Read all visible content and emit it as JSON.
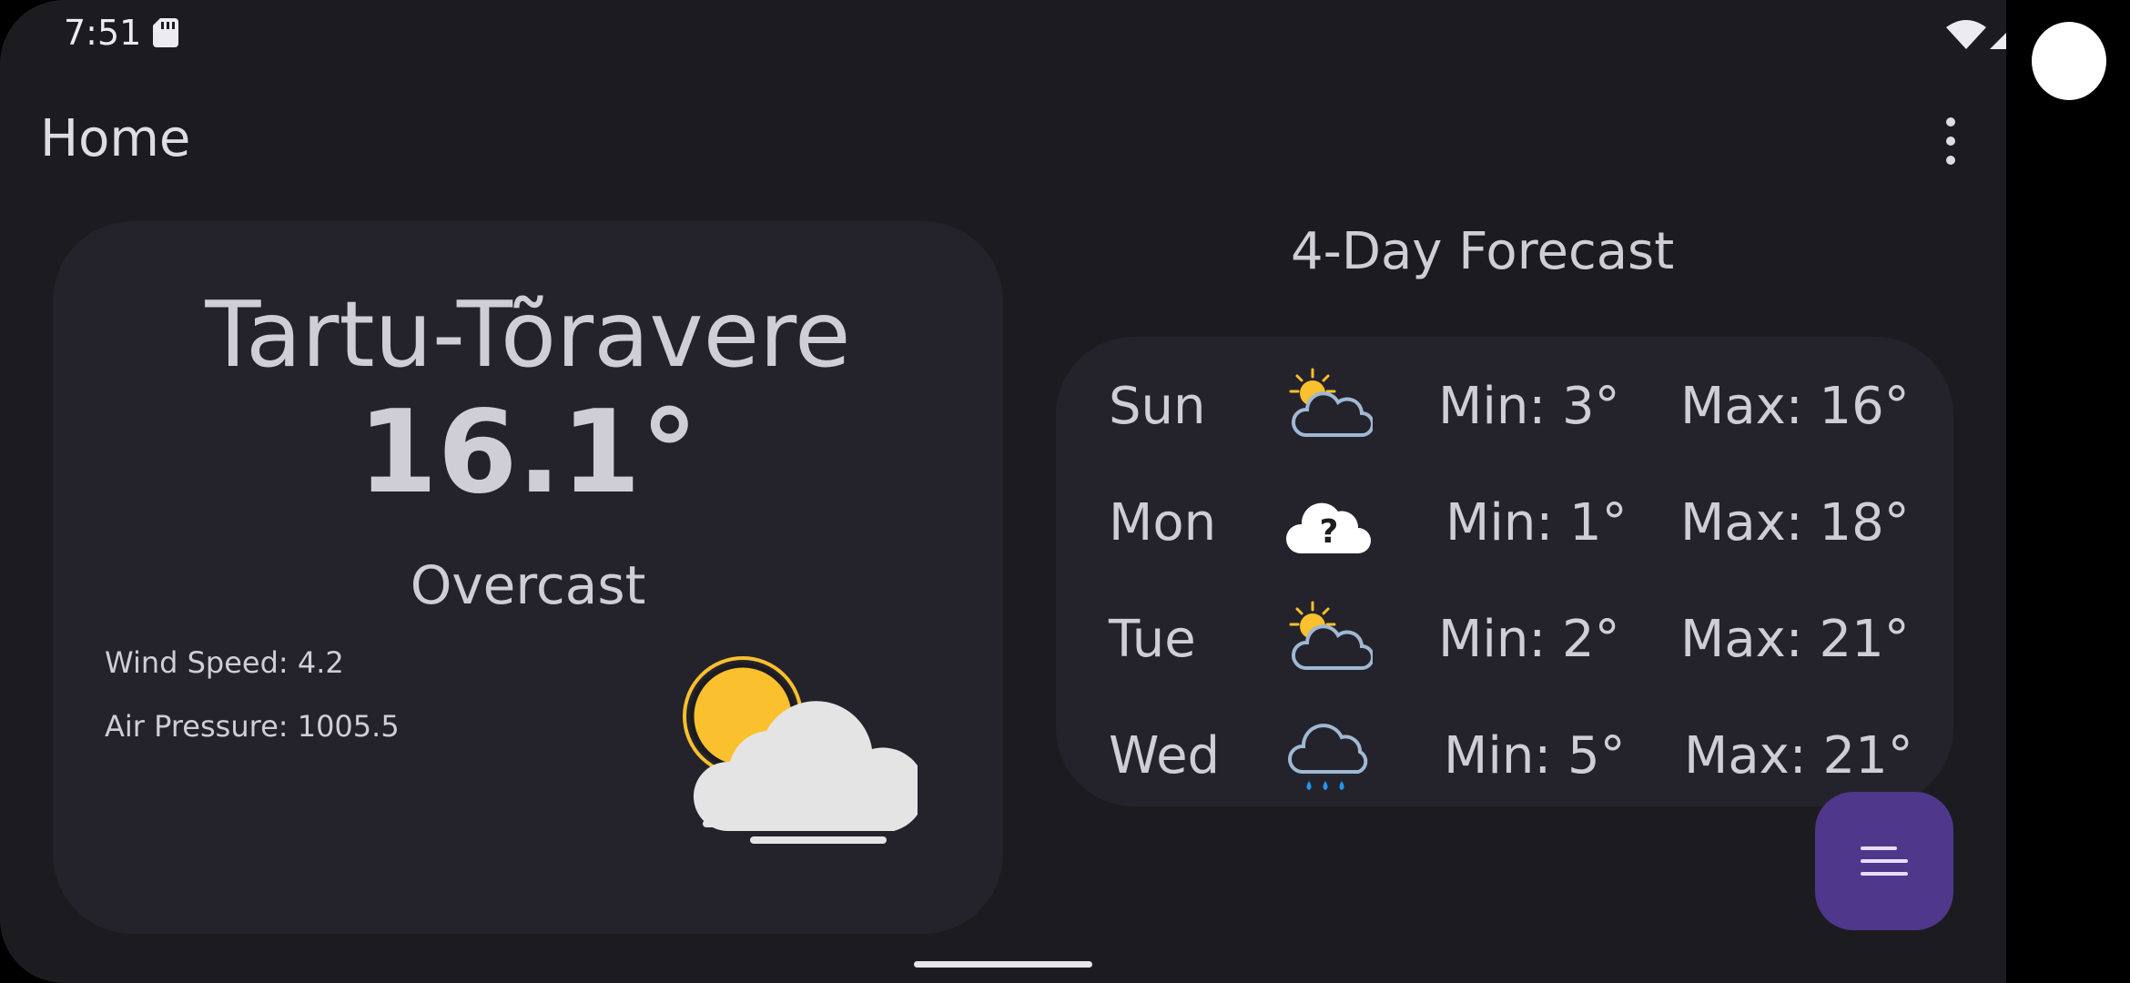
{
  "status_bar": {
    "time": "7:51"
  },
  "app_bar": {
    "title": "Home"
  },
  "current": {
    "city": "Tartu-Tõravere",
    "temperature": "16.1°",
    "condition": "Overcast",
    "wind_speed": "Wind Speed: 4.2",
    "air_pressure": "Air Pressure: 1005.5",
    "icon": "sun-cloud-fog-icon"
  },
  "forecast": {
    "title": "4-Day Forecast",
    "days": [
      {
        "day": "Sun",
        "icon": "partly-sunny-icon",
        "min": "Min: 3°",
        "max": "Max: 16°"
      },
      {
        "day": "Mon",
        "icon": "unknown-weather-icon",
        "min": "Min: 1°",
        "max": "Max: 18°"
      },
      {
        "day": "Tue",
        "icon": "partly-sunny-icon",
        "min": "Min: 2°",
        "max": "Max: 21°"
      },
      {
        "day": "Wed",
        "icon": "rain-icon",
        "min": "Min: 5°",
        "max": "Max: 21°"
      }
    ]
  },
  "colors": {
    "background": "#1c1b20",
    "card": "#24232b",
    "fab": "#4f378b",
    "sun": "#fbc02d"
  }
}
